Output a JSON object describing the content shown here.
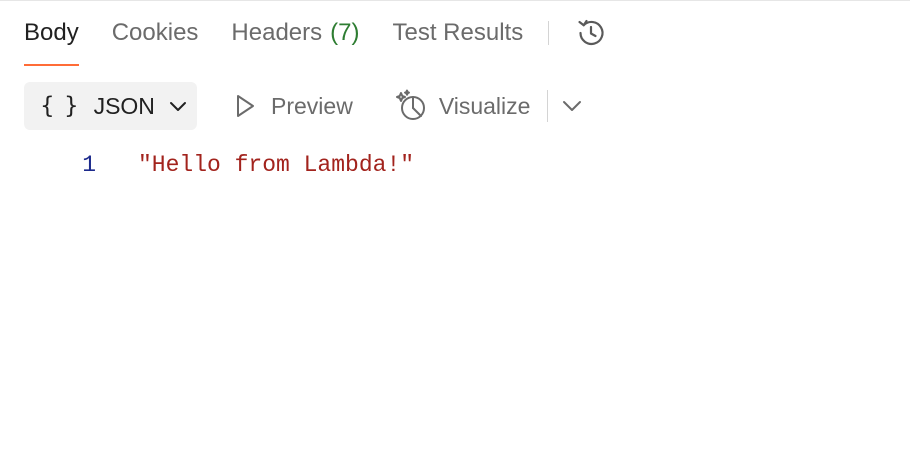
{
  "tabs": [
    {
      "label": "Body",
      "active": true
    },
    {
      "label": "Cookies",
      "active": false
    },
    {
      "label": "Headers",
      "count": "(7)",
      "active": false
    },
    {
      "label": "Test Results",
      "active": false
    }
  ],
  "history": {
    "icon": "history-icon"
  },
  "toolbar": {
    "format_icon": "braces-icon",
    "format_braces": "{ }",
    "format_label": "JSON",
    "preview_icon": "play-icon",
    "preview_label": "Preview",
    "visualize_icon": "visualize-icon",
    "visualize_label": "Visualize",
    "more_icon": "chevron-down-icon"
  },
  "response_body": {
    "lines": [
      {
        "number": "1",
        "content": "\"Hello from Lambda!\""
      }
    ]
  },
  "colors": {
    "active_tab_underline": "#ff6c37",
    "headers_count": "#2e7d32",
    "line_number": "#1c2a8c",
    "string_value": "#a2231d",
    "format_select_bg": "#f2f2f2"
  }
}
